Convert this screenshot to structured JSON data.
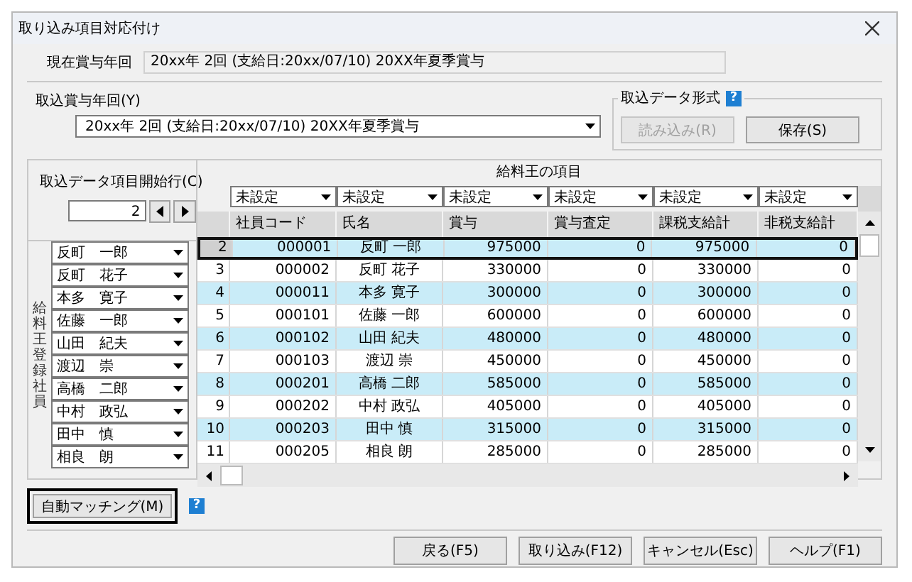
{
  "window": {
    "title": "取り込み項目対応付け"
  },
  "current": {
    "label": "現在賞与年回",
    "value": "20xx年 2回 (支給日:20xx/07/10) 20XX年夏季賞与"
  },
  "import_period": {
    "label": "取込賞与年回(Y)",
    "value": "20xx年 2回 (支給日:20xx/07/10) 20XX年夏季賞与"
  },
  "format_group": {
    "title": "取込データ形式",
    "help": "?",
    "buttons": [
      {
        "label": "読み込み(R)",
        "disabled": true
      },
      {
        "label": "保存(S)",
        "disabled": false
      }
    ]
  },
  "start_row": {
    "label": "取込データ項目開始行(C)",
    "value": "2"
  },
  "employee_label": "給料王登録社員",
  "mapping": {
    "title": "給料王の項目",
    "selects": [
      "未設定",
      "未設定",
      "未設定",
      "未設定",
      "未設定",
      "未設定"
    ]
  },
  "table": {
    "columns": [
      "社員コード",
      "氏名",
      "賞与",
      "賞与査定",
      "課税支給計",
      "非税支給計"
    ],
    "rows": [
      {
        "employee": "反町　一郎",
        "number": "2",
        "cells": [
          "000001",
          "反町 一郎",
          "975000",
          "0",
          "975000",
          "0"
        ],
        "selected": true
      },
      {
        "employee": "反町　花子",
        "number": "3",
        "cells": [
          "000002",
          "反町 花子",
          "330000",
          "0",
          "330000",
          "0"
        ],
        "selected": false
      },
      {
        "employee": "本多　寛子",
        "number": "4",
        "cells": [
          "000011",
          "本多 寛子",
          "300000",
          "0",
          "300000",
          "0"
        ],
        "selected": false
      },
      {
        "employee": "佐藤　一郎",
        "number": "5",
        "cells": [
          "000101",
          "佐藤 一郎",
          "600000",
          "0",
          "600000",
          "0"
        ],
        "selected": false
      },
      {
        "employee": "山田　紀夫",
        "number": "6",
        "cells": [
          "000102",
          "山田 紀夫",
          "480000",
          "0",
          "480000",
          "0"
        ],
        "selected": false
      },
      {
        "employee": "渡辺　崇",
        "number": "7",
        "cells": [
          "000103",
          "渡辺 崇",
          "450000",
          "0",
          "450000",
          "0"
        ],
        "selected": false
      },
      {
        "employee": "高橋　二郎",
        "number": "8",
        "cells": [
          "000201",
          "高橋 二郎",
          "585000",
          "0",
          "585000",
          "0"
        ],
        "selected": false
      },
      {
        "employee": "中村　政弘",
        "number": "9",
        "cells": [
          "000202",
          "中村 政弘",
          "405000",
          "0",
          "405000",
          "0"
        ],
        "selected": false
      },
      {
        "employee": "田中　慎",
        "number": "10",
        "cells": [
          "000203",
          "田中 慎",
          "315000",
          "0",
          "315000",
          "0"
        ],
        "selected": false
      },
      {
        "employee": "相良　朗",
        "number": "11",
        "cells": [
          "000205",
          "相良 朗",
          "285000",
          "0",
          "285000",
          "0"
        ],
        "selected": false
      }
    ]
  },
  "auto_match": {
    "label": "自動マッチング(M)",
    "focused": true,
    "help": "?"
  },
  "footer_buttons": [
    "戻る(F5)",
    "取り込み(F12)",
    "キャンセル(Esc)",
    "ヘルプ(F1)"
  ]
}
